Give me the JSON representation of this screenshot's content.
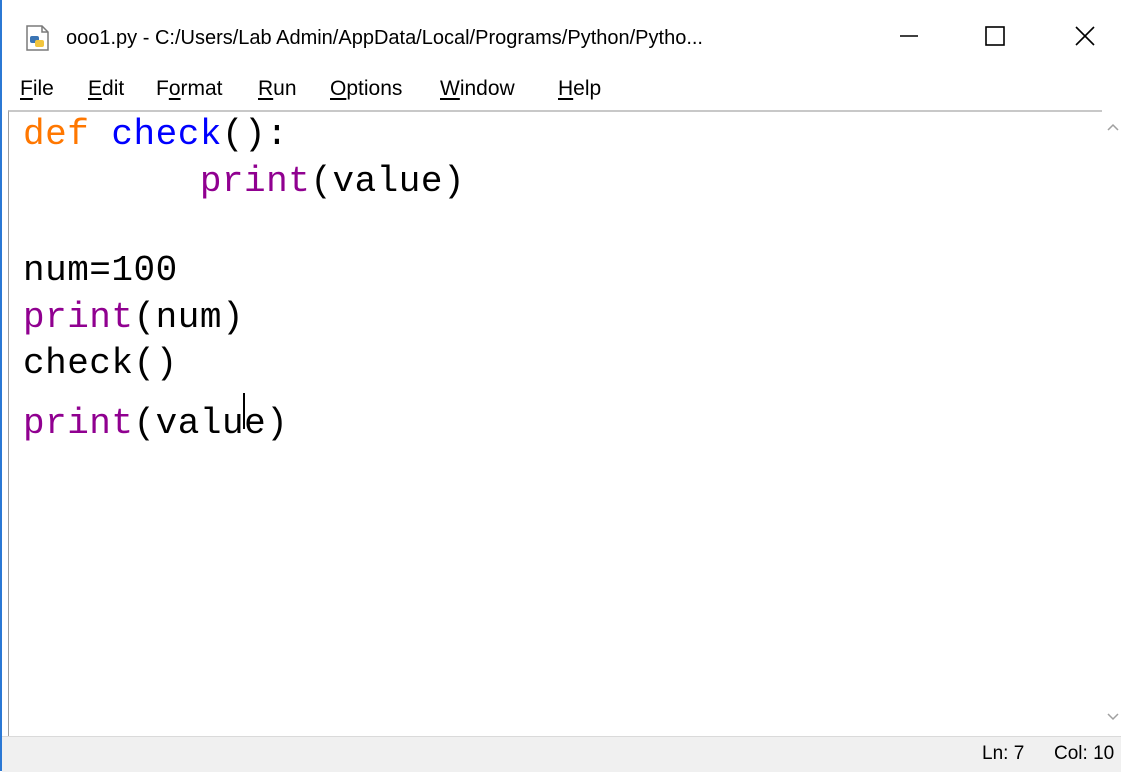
{
  "window": {
    "title": "ooo1.py - C:/Users/Lab Admin/AppData/Local/Programs/Python/Pytho...",
    "icon": "python-file-icon",
    "controls": {
      "minimize": "minimize-icon",
      "maximize": "maximize-icon",
      "close": "close-icon"
    }
  },
  "menu": {
    "items": [
      {
        "label": "File",
        "mnemonic": "F"
      },
      {
        "label": "Edit",
        "mnemonic": "E"
      },
      {
        "label": "Format",
        "mnemonic": "o"
      },
      {
        "label": "Run",
        "mnemonic": "R"
      },
      {
        "label": "Options",
        "mnemonic": "O"
      },
      {
        "label": "Window",
        "mnemonic": "W"
      },
      {
        "label": "Help",
        "mnemonic": "H"
      }
    ]
  },
  "editor": {
    "lines": [
      [
        {
          "t": "def",
          "c": "kw"
        },
        {
          "t": " "
        },
        {
          "t": "check",
          "c": "fn"
        },
        {
          "t": "():"
        }
      ],
      [
        {
          "t": "        "
        },
        {
          "t": "print",
          "c": "bi"
        },
        {
          "t": "(value)"
        }
      ],
      [
        {
          "t": ""
        }
      ],
      [
        {
          "t": "num=100"
        }
      ],
      [
        {
          "t": "print",
          "c": "bi"
        },
        {
          "t": "(num)"
        }
      ],
      [
        {
          "t": "check()"
        }
      ],
      [
        {
          "t": "print",
          "c": "bi"
        },
        {
          "t": "(valu"
        },
        {
          "t": "e)"
        }
      ]
    ],
    "syntax_colors": {
      "keyword": "#ff7700",
      "definition": "#0000ff",
      "builtin": "#900090",
      "default": "#000000"
    }
  },
  "status": {
    "line": "Ln: 7",
    "col": "Col: 10"
  },
  "colors": {
    "accent_border": "#2b78d4",
    "statusbar_bg": "#f0f0f0"
  }
}
